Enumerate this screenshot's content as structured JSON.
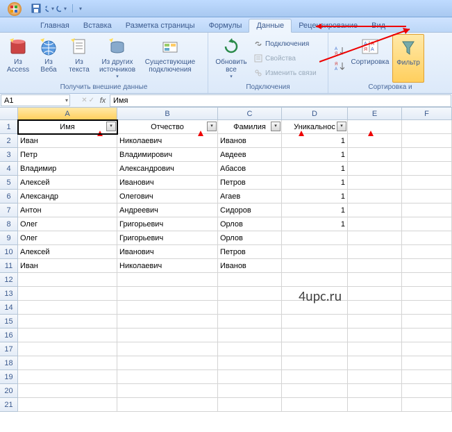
{
  "qat": {
    "save": "save",
    "undo": "undo",
    "redo": "redo"
  },
  "tabs": {
    "home": "Главная",
    "insert": "Вставка",
    "page": "Разметка страницы",
    "formulas": "Формулы",
    "data": "Данные",
    "review": "Рецензирование",
    "view": "Вид"
  },
  "ribbon": {
    "group_external": "Получить внешние данные",
    "group_connections": "Подключения",
    "group_sort": "Сортировка и",
    "btn_access": "Из\nAccess",
    "btn_web": "Из\nВеба",
    "btn_text": "Из\nтекста",
    "btn_other": "Из других\nисточников",
    "btn_existing": "Существующие\nподключения",
    "btn_refresh": "Обновить\nвсе",
    "btn_conn": "Подключения",
    "btn_props": "Свойства",
    "btn_links": "Изменить связи",
    "btn_sort": "Сортировка",
    "btn_filter": "Фильтр"
  },
  "namebox": "A1",
  "formula": "Имя",
  "columns": [
    "A",
    "B",
    "C",
    "D",
    "E",
    "F"
  ],
  "headers": {
    "name": "Имя",
    "patronymic": "Отчество",
    "surname": "Фамилия",
    "unique": "Уникальнос"
  },
  "rows": [
    {
      "a": "Иван",
      "b": "Николаевич",
      "c": "Иванов",
      "d": "1"
    },
    {
      "a": "Петр",
      "b": "Владимирович",
      "c": "Авдеев",
      "d": "1"
    },
    {
      "a": "Владимир",
      "b": "Александрович",
      "c": "Абасов",
      "d": "1"
    },
    {
      "a": "Алексей",
      "b": "Иванович",
      "c": "Петров",
      "d": "1"
    },
    {
      "a": "Александр",
      "b": "Олегович",
      "c": "Агаев",
      "d": "1"
    },
    {
      "a": "Антон",
      "b": "Андреевич",
      "c": "Сидоров",
      "d": "1"
    },
    {
      "a": "Олег",
      "b": "Григорьевич",
      "c": "Орлов",
      "d": "1"
    },
    {
      "a": "Олег",
      "b": "Григорьевич",
      "c": "Орлов",
      "d": ""
    },
    {
      "a": "Алексей",
      "b": "Иванович",
      "c": "Петров",
      "d": ""
    },
    {
      "a": "Иван",
      "b": "Николаевич",
      "c": "Иванов",
      "d": ""
    }
  ],
  "watermark": "4upc.ru"
}
